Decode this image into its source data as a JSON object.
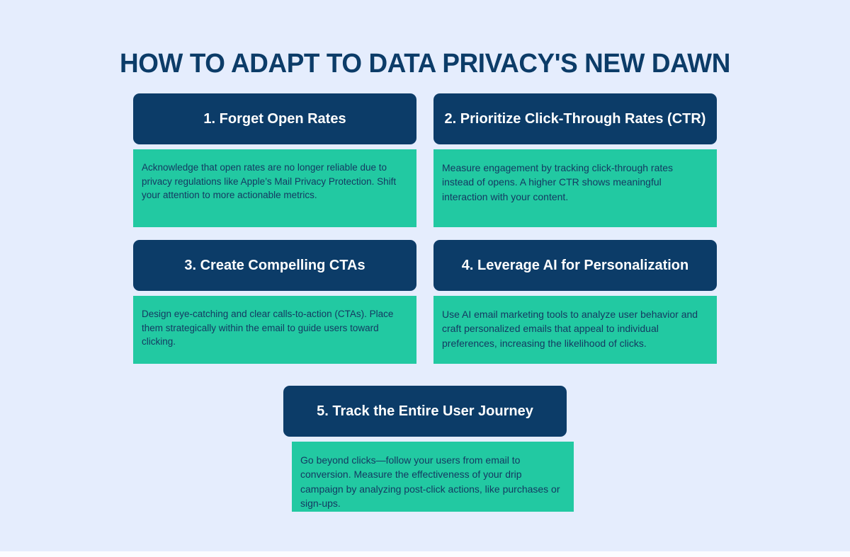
{
  "page": {
    "title": "HOW TO ADAPT TO DATA PRIVACY'S NEW DAWN",
    "background_color": "#e5edfd",
    "accent_navy": "#0c3c68",
    "accent_teal": "#22c9a2",
    "body_text_color": "#143a62"
  },
  "cards": [
    {
      "number": "1",
      "header": "1. Forget Open Rates",
      "body": "Acknowledge that open rates are no longer reliable due to privacy regulations like Apple’s Mail Privacy Protection. Shift your attention to more actionable metrics."
    },
    {
      "number": "2",
      "header": "2. Prioritize Click-Through Rates (CTR)",
      "body": "Measure engagement by tracking click-through rates instead of opens. A higher CTR shows meaningful interaction with your content."
    },
    {
      "number": "3",
      "header": "3. Create Compelling CTAs",
      "body": "Design eye-catching and clear calls-to-action (CTAs). Place them strategically within the email to guide users toward clicking."
    },
    {
      "number": "4",
      "header": "4. Leverage AI for Personalization",
      "body": "Use AI email marketing tools to analyze user behavior and craft personalized emails that appeal to individual preferences, increasing the likelihood of clicks."
    },
    {
      "number": "5",
      "header": "5. Track the Entire User Journey",
      "body": "Go beyond clicks—follow your users from email to conversion. Measure the effectiveness of your drip campaign by analyzing post-click actions, like purchases or sign-ups."
    }
  ]
}
